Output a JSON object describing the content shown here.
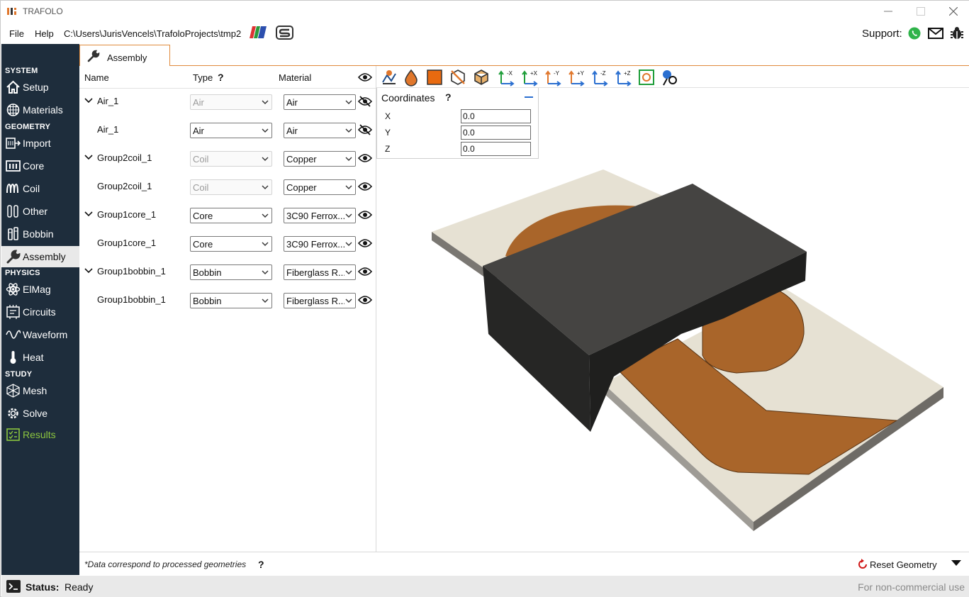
{
  "window": {
    "title": "TRAFOLO",
    "minimize": "minimize",
    "maximize": "maximize",
    "close": "close"
  },
  "menu": {
    "file": "File",
    "help": "Help",
    "path": "C:\\Users\\JurisVencels\\TrafoloProjects\\tmp2",
    "support_label": "Support:"
  },
  "sidebar": {
    "sections": {
      "system": "SYSTEM",
      "geometry": "GEOMETRY",
      "physics": "PHYSICS",
      "study": "STUDY"
    },
    "items": [
      {
        "label": "Setup",
        "icon": "home-icon"
      },
      {
        "label": "Materials",
        "icon": "globe-grid-icon"
      },
      {
        "label": "Import",
        "icon": "import-icon"
      },
      {
        "label": "Core",
        "icon": "core-icon"
      },
      {
        "label": "Coil",
        "icon": "coil-icon"
      },
      {
        "label": "Other",
        "icon": "other-icon"
      },
      {
        "label": "Bobbin",
        "icon": "bobbin-icon"
      },
      {
        "label": "Assembly",
        "icon": "wrench-icon",
        "active": true
      },
      {
        "label": "ElMag",
        "icon": "atom-icon"
      },
      {
        "label": "Circuits",
        "icon": "circuit-icon"
      },
      {
        "label": "Waveform",
        "icon": "wave-icon"
      },
      {
        "label": "Heat",
        "icon": "thermometer-icon"
      },
      {
        "label": "Mesh",
        "icon": "mesh-icon"
      },
      {
        "label": "Solve",
        "icon": "solve-gear-icon"
      },
      {
        "label": "Results",
        "icon": "results-icon",
        "color": "#8cc63f"
      }
    ]
  },
  "tab": {
    "label": "Assembly"
  },
  "table": {
    "headers": {
      "name": "Name",
      "type": "Type",
      "type_help": "?",
      "material": "Material"
    },
    "rows": [
      {
        "name": "Air_1",
        "type": "Air",
        "material": "Air",
        "expandable": true,
        "type_disabled": true,
        "visible": false
      },
      {
        "name": "Air_1",
        "type": "Air",
        "material": "Air",
        "expandable": false,
        "type_disabled": false,
        "visible": false
      },
      {
        "name": "Group2coil_1",
        "type": "Coil",
        "material": "Copper",
        "expandable": true,
        "type_disabled": true,
        "visible": true
      },
      {
        "name": "Group2coil_1",
        "type": "Coil",
        "material": "Copper",
        "expandable": false,
        "type_disabled": true,
        "visible": true
      },
      {
        "name": "Group1core_1",
        "type": "Core",
        "material": "3C90 Ferrox...",
        "expandable": true,
        "type_disabled": false,
        "visible": true
      },
      {
        "name": "Group1core_1",
        "type": "Core",
        "material": "3C90 Ferrox...",
        "expandable": false,
        "type_disabled": false,
        "visible": true
      },
      {
        "name": "Group1bobbin_1",
        "type": "Bobbin",
        "material": "Fiberglass R...",
        "expandable": true,
        "type_disabled": false,
        "visible": true
      },
      {
        "name": "Group1bobbin_1",
        "type": "Bobbin",
        "material": "Fiberglass R...",
        "expandable": false,
        "type_disabled": false,
        "visible": true
      }
    ]
  },
  "footer": {
    "note": "*Data correspond to processed geometries",
    "help": "?",
    "reset": "Reset Geometry"
  },
  "coordinates": {
    "title": "Coordinates",
    "help": "?",
    "x_label": "X",
    "x_value": "0.0",
    "y_label": "Y",
    "y_value": "0.0",
    "z_label": "Z",
    "z_value": "0.0"
  },
  "toolbar": {
    "axis_labels": [
      "-X",
      "+X",
      "-Y",
      "+Y",
      "-Z",
      "+Z"
    ]
  },
  "status": {
    "label": "Status:",
    "value": "Ready",
    "license": "For non-commercial use"
  },
  "colors": {
    "sidebar_bg": "#1e2d3c",
    "accent_orange": "#e08a3c",
    "results_green": "#8cc63f",
    "core_dark": "#3a3a38",
    "copper": "#a9652a",
    "board": "#e6e1d3"
  }
}
